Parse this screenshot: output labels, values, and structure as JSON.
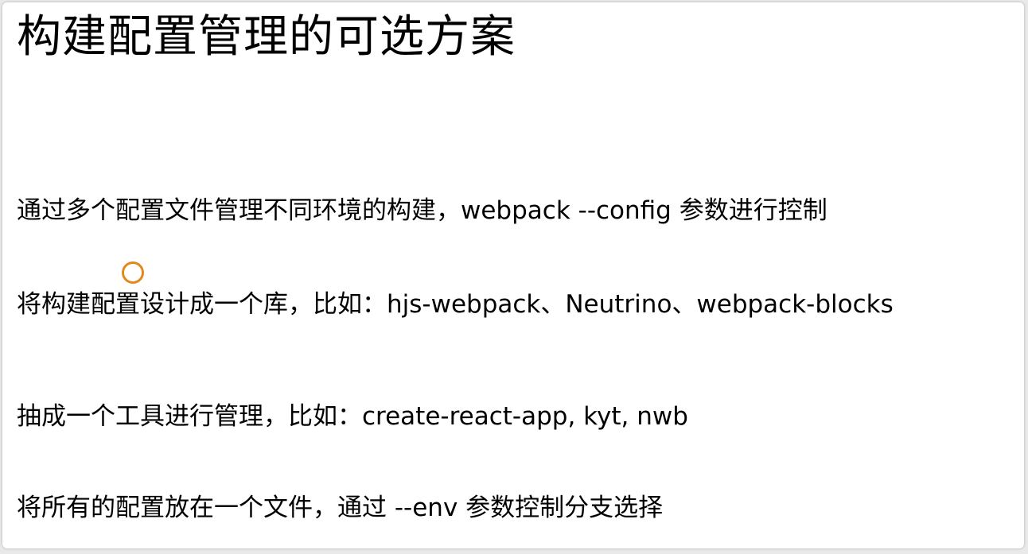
{
  "slide": {
    "title": "构建配置管理的可选方案",
    "bullets": [
      "通过多个配置文件管理不同环境的构建，webpack --config 参数进行控制",
      "将构建配置设计成一个库，比如：hjs-webpack、Neutrino、webpack-blocks",
      "抽成一个工具进行管理，比如：create-react-app, kyt, nwb",
      "将所有的配置放在一个文件，通过 --env 参数控制分支选择"
    ]
  },
  "colors": {
    "background": "#ffffff",
    "text": "#000000",
    "cursor_ring": "#e08a1e"
  },
  "icons": {
    "cursor": "cursor-highlight-ring"
  }
}
